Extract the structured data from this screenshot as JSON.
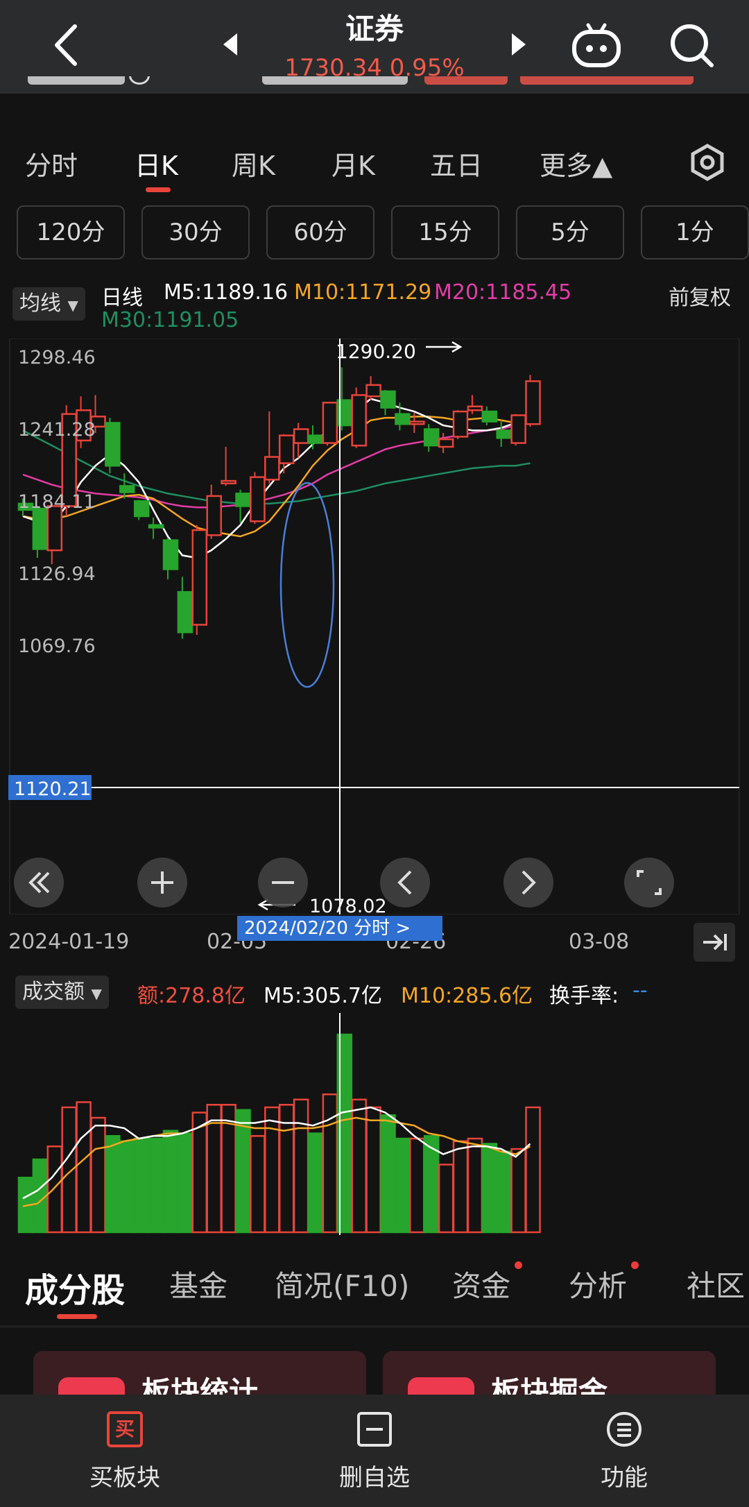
{
  "header": {
    "title": "证券",
    "price": "1730.34 0.95%"
  },
  "period_tabs": [
    {
      "label": "分时"
    },
    {
      "label": "日K"
    },
    {
      "label": "周K"
    },
    {
      "label": "月K"
    },
    {
      "label": "五日"
    },
    {
      "label": "更多▲"
    }
  ],
  "minute_buttons": [
    {
      "label": "120分"
    },
    {
      "label": "30分"
    },
    {
      "label": "60分"
    },
    {
      "label": "15分"
    },
    {
      "label": "5分"
    },
    {
      "label": "1分"
    }
  ],
  "ma_bar": {
    "selector": "均线",
    "type_label": "日线",
    "m5": "M5:1189.16",
    "m10": "M10:1171.29",
    "m20": "M20:1185.45",
    "m30": "M30:1191.05",
    "adjust": "前复权"
  },
  "price_chart": {
    "y_labels": [
      "1298.46",
      "1241.28",
      "1184.11",
      "1126.94",
      "1069.76"
    ],
    "crosshair_price": "1120.21",
    "high_marker": "1290.20",
    "low_marker": "1078.02",
    "dates": [
      "2024-01-19",
      "02-05",
      "02-26",
      "03-08"
    ],
    "crosshair_date": "2024/02/20  分时 >"
  },
  "volume_bar": {
    "selector": "成交额",
    "amount": "额:278.8亿",
    "m5": "M5:305.7亿",
    "m10": "M10:285.6亿",
    "turnover": "换手率:",
    "turnover_value": "--"
  },
  "bottom_tabs": [
    {
      "label": "成分股"
    },
    {
      "label": "基金"
    },
    {
      "label": "简况(F10)"
    },
    {
      "label": "资金"
    },
    {
      "label": "分析"
    },
    {
      "label": "社区"
    }
  ],
  "cards": [
    {
      "label": "板块统计"
    },
    {
      "label": "板块掘金"
    }
  ],
  "nav": [
    {
      "label": "买板块",
      "icon_text": "买"
    },
    {
      "label": "删自选"
    },
    {
      "label": "功能"
    }
  ],
  "colors": {
    "up": "#e8443a",
    "down": "#27a52c",
    "m5": "#ffffff",
    "m10": "#f5a623",
    "m20": "#e33ca7",
    "m30": "#1e8f62",
    "accent_blue": "#2f6fd1"
  },
  "chart_data": {
    "type": "candlestick",
    "y_axis_labels": [
      1298.46,
      1241.28,
      1184.11,
      1126.94,
      1069.76
    ],
    "ylim": [
      1069.76,
      1298.46
    ],
    "candles": [
      {
        "o": 1182,
        "c": 1177,
        "h": 1186,
        "l": 1172
      },
      {
        "o": 1178,
        "c": 1146,
        "h": 1180,
        "l": 1139
      },
      {
        "o": 1145,
        "c": 1180,
        "h": 1182,
        "l": 1134
      },
      {
        "o": 1180,
        "c": 1253,
        "h": 1260,
        "l": 1172
      },
      {
        "o": 1232,
        "c": 1256,
        "h": 1267,
        "l": 1226
      },
      {
        "o": 1243,
        "c": 1251,
        "h": 1268,
        "l": 1238
      },
      {
        "o": 1246,
        "c": 1212,
        "h": 1250,
        "l": 1206
      },
      {
        "o": 1196,
        "c": 1191,
        "h": 1206,
        "l": 1186
      },
      {
        "o": 1184,
        "c": 1172,
        "h": 1185,
        "l": 1169
      },
      {
        "o": 1165,
        "c": 1163,
        "h": 1171,
        "l": 1154
      },
      {
        "o": 1153,
        "c": 1130,
        "h": 1155,
        "l": 1122
      },
      {
        "o": 1112,
        "c": 1080,
        "h": 1124,
        "l": 1075
      },
      {
        "o": 1086,
        "c": 1161,
        "h": 1165,
        "l": 1078
      },
      {
        "o": 1157,
        "c": 1188,
        "h": 1197,
        "l": 1154
      },
      {
        "o": 1198,
        "c": 1200,
        "h": 1227,
        "l": 1196
      },
      {
        "o": 1190,
        "c": 1180,
        "h": 1193,
        "l": 1167
      },
      {
        "o": 1168,
        "c": 1203,
        "h": 1207,
        "l": 1166
      },
      {
        "o": 1201,
        "c": 1219,
        "h": 1255,
        "l": 1198
      },
      {
        "o": 1214,
        "c": 1236,
        "h": 1237,
        "l": 1206
      },
      {
        "o": 1230,
        "c": 1241,
        "h": 1246,
        "l": 1218
      },
      {
        "o": 1236,
        "c": 1230,
        "h": 1244,
        "l": 1225
      },
      {
        "o": 1230,
        "c": 1262,
        "h": 1262,
        "l": 1228
      },
      {
        "o": 1264,
        "c": 1244,
        "h": 1290,
        "l": 1240
      },
      {
        "o": 1228,
        "c": 1268,
        "h": 1274,
        "l": 1226
      },
      {
        "o": 1267,
        "c": 1276,
        "h": 1283,
        "l": 1264
      },
      {
        "o": 1271,
        "c": 1258,
        "h": 1272,
        "l": 1252
      },
      {
        "o": 1253,
        "c": 1245,
        "h": 1262,
        "l": 1240
      },
      {
        "o": 1245,
        "c": 1247,
        "h": 1254,
        "l": 1238
      },
      {
        "o": 1241,
        "c": 1228,
        "h": 1245,
        "l": 1223
      },
      {
        "o": 1227,
        "c": 1233,
        "h": 1238,
        "l": 1222
      },
      {
        "o": 1235,
        "c": 1255,
        "h": 1256,
        "l": 1233
      },
      {
        "o": 1256,
        "c": 1259,
        "h": 1268,
        "l": 1253
      },
      {
        "o": 1255,
        "c": 1247,
        "h": 1259,
        "l": 1244
      },
      {
        "o": 1240,
        "c": 1234,
        "h": 1248,
        "l": 1227
      },
      {
        "o": 1230,
        "c": 1252,
        "h": 1253,
        "l": 1228
      },
      {
        "o": 1245,
        "c": 1279,
        "h": 1284,
        "l": 1243
      }
    ],
    "m5": [
      1172,
      1168,
      1166,
      1180,
      1199,
      1212,
      1221,
      1212,
      1199,
      1177,
      1156,
      1141,
      1139,
      1145,
      1154,
      1165,
      1182,
      1196,
      1210,
      1218,
      1229,
      1240,
      1248,
      1256,
      1265,
      1262,
      1258,
      1255,
      1250,
      1244,
      1242,
      1240,
      1240,
      1242,
      1246,
      1253
    ],
    "m10": [
      1172,
      1170,
      1170,
      1172,
      1176,
      1180,
      1184,
      1188,
      1189,
      1186,
      1178,
      1170,
      1163,
      1160,
      1158,
      1156,
      1160,
      1168,
      1182,
      1196,
      1212,
      1224,
      1233,
      1240,
      1248,
      1250,
      1250,
      1251,
      1251,
      1250,
      1248,
      1249,
      1250,
      1248,
      1246,
      1248
    ],
    "m20": [
      1205,
      1201,
      1197,
      1194,
      1192,
      1190,
      1189,
      1188,
      1187,
      1185,
      1182,
      1180,
      1179,
      1179,
      1180,
      1181,
      1183,
      1186,
      1189,
      1193,
      1198,
      1205,
      1210,
      1215,
      1220,
      1225,
      1228,
      1230,
      1232,
      1234,
      1236,
      1238,
      1240,
      1241,
      1244,
      1247
    ],
    "m30": [
      1240,
      1234,
      1228,
      1222,
      1216,
      1210,
      1204,
      1200,
      1196,
      1193,
      1190,
      1188,
      1186,
      1184,
      1183,
      1182,
      1182,
      1182,
      1183,
      1184,
      1186,
      1188,
      1190,
      1192,
      1195,
      1198,
      1200,
      1202,
      1204,
      1206,
      1208,
      1210,
      1211,
      1212,
      1212,
      1214
    ],
    "volume": [
      21,
      28,
      33,
      48,
      50,
      44,
      37,
      35,
      36,
      36,
      39,
      38,
      46,
      49,
      49,
      47,
      37,
      48,
      49,
      51,
      38,
      53,
      76,
      51,
      48,
      45,
      36,
      36,
      37,
      26,
      35,
      36,
      34,
      31,
      32,
      48
    ],
    "vol_m5": [
      13,
      16,
      21,
      28,
      36,
      41,
      41,
      40,
      36,
      37,
      37,
      38,
      40,
      43,
      43,
      42,
      42,
      43,
      42,
      42,
      41,
      43,
      46,
      47,
      48,
      46,
      42,
      37,
      33,
      30,
      32,
      33,
      33,
      32,
      29,
      34
    ],
    "vol_m10": [
      10,
      11,
      16,
      22,
      27,
      32,
      33,
      35,
      36,
      37,
      38,
      38,
      40,
      42,
      42,
      41,
      40,
      40,
      39,
      40,
      40,
      41,
      43,
      44,
      43,
      43,
      42,
      41,
      38,
      37,
      35,
      34,
      33,
      31,
      30,
      33
    ]
  }
}
